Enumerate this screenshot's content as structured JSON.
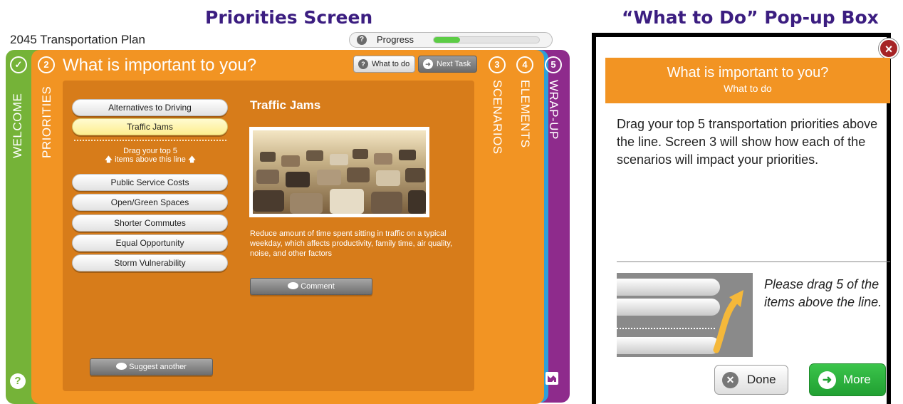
{
  "headings": {
    "left": "Priorities Screen",
    "right": "“What to Do” Pop-up Box"
  },
  "app": {
    "title": "2045 Transportation Plan",
    "progress": {
      "label": "Progress",
      "value": 0.25
    }
  },
  "tabs": [
    {
      "number": "✓",
      "label": "WELCOME",
      "color": "#75b338"
    },
    {
      "number": "2",
      "label": "PRIORITIES",
      "color": "#f29423"
    },
    {
      "number": "3",
      "label": "SCENARIOS",
      "color": "#ee3a37"
    },
    {
      "number": "4",
      "label": "ELEMENTS",
      "color": "#2e9fd9"
    },
    {
      "number": "5",
      "label": "WRAP-UP",
      "color": "#8e2b8c"
    }
  ],
  "screen": {
    "title": "What is important to you?",
    "what_to_do": "What to do",
    "next_task": "Next Task"
  },
  "priorities": {
    "above": [
      "Alternatives to Driving",
      "Traffic Jams"
    ],
    "hint_line1": "Drag your top 5",
    "hint_line2": "🡅 items above this line 🡅",
    "below": [
      "Public Service Costs",
      "Open/Green Spaces",
      "Shorter Commutes",
      "Equal Opportunity",
      "Storm Vulnerability"
    ]
  },
  "detail": {
    "title": "Traffic Jams",
    "description": "Reduce amount of time spent sitting in traffic on a typical weekday, which affects productivity, family time, air quality, noise, and other factors",
    "comment": "Comment"
  },
  "suggest_another": "Suggest another",
  "help_icon": "?",
  "popup": {
    "title": "What is important to you?",
    "subtitle": "What to do",
    "body": "Drag your top 5 transportation priorities above the line. Screen 3 will show how each of the scenarios will impact your priorities.",
    "note": "Please drag 5 of the items above the line.",
    "done": "Done",
    "more": "More",
    "close_icon": "×"
  },
  "colors": {
    "heading": "#3b1d80",
    "orange": "#f29423",
    "green_button": "#21a032"
  }
}
